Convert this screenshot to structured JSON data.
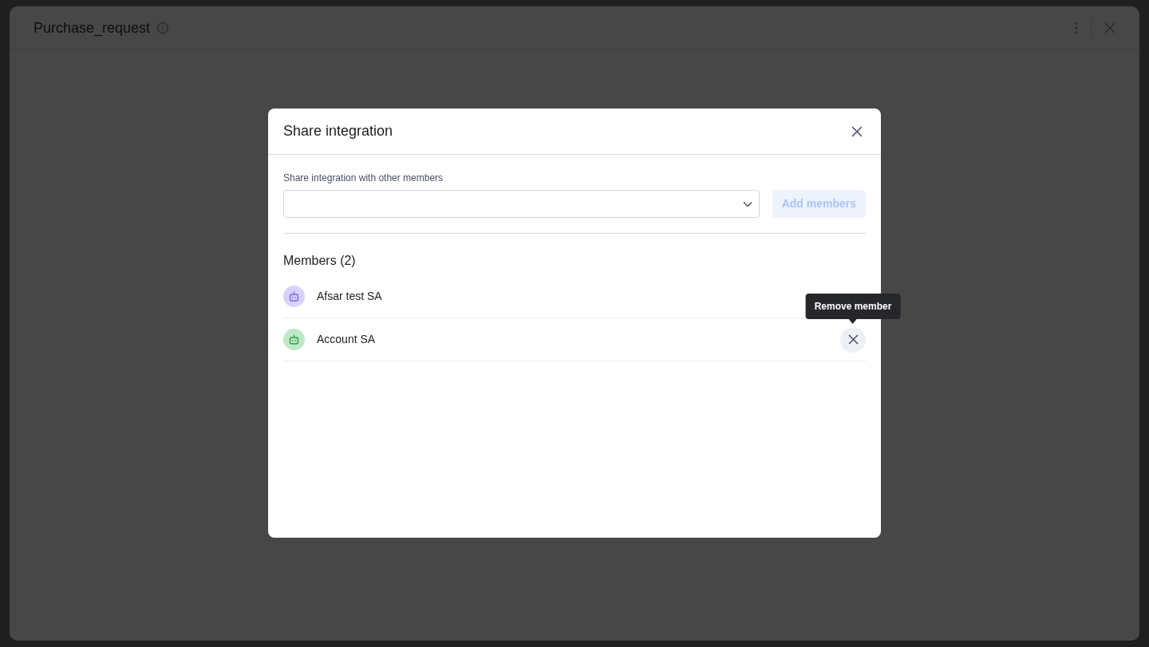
{
  "window": {
    "title": "Purchase_request"
  },
  "dialog": {
    "title": "Share integration",
    "field_label": "Share integration with other members",
    "add_button": {
      "label": "Add members",
      "disabled": true
    },
    "members_heading": "Members (2)",
    "members": [
      {
        "name": "Afsar test SA",
        "color": "#d9d3fb",
        "show_remove": false
      },
      {
        "name": "Account SA",
        "color": "#bfe8c6",
        "show_remove": true
      }
    ],
    "tooltip": "Remove member"
  }
}
